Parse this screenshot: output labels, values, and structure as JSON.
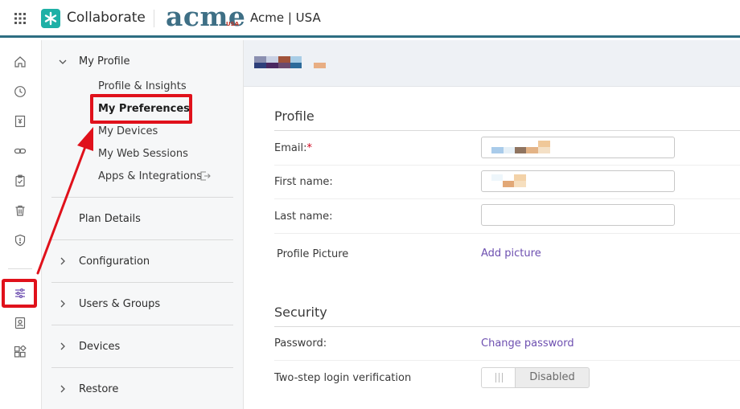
{
  "topbar": {
    "app_name": "Collaborate",
    "partner_logo_text": "acme",
    "partner_logo_sub": "USA",
    "tenant_name": "Acme | USA"
  },
  "rail": {
    "icons": [
      "home-icon",
      "history-icon",
      "archive-icon",
      "link-icon",
      "clipboard-check-icon",
      "trash-icon",
      "shield-alert-icon",
      "preferences-sliders-icon",
      "contact-book-icon",
      "apps-icon"
    ],
    "highlighted": "preferences-sliders-icon"
  },
  "sidenav": {
    "my_profile": {
      "label": "My Profile",
      "items": {
        "profile_insights": "Profile & Insights",
        "my_preferences": "My Preferences",
        "my_devices": "My Devices",
        "my_web_sessions": "My Web Sessions",
        "apps_integrations": "Apps & Integrations"
      }
    },
    "plan_details": "Plan Details",
    "configuration": "Configuration",
    "users_groups": "Users & Groups",
    "devices": "Devices",
    "restore": "Restore"
  },
  "profile": {
    "title": "Profile",
    "email_label": "Email:",
    "email_required_mark": "*",
    "first_name_label": "First name:",
    "last_name_label": "Last name:",
    "last_name_value": "",
    "picture_label": "Profile Picture",
    "add_picture": "Add picture"
  },
  "security": {
    "title": "Security",
    "password_label": "Password:",
    "change_password": "Change password",
    "two_step_label": "Two-step login verification",
    "two_step_state": "Disabled"
  },
  "colors": {
    "accent": "#2e6e82",
    "link": "#6d4fb0",
    "highlight": "#e0111b",
    "brand": "#1eb0a6"
  }
}
